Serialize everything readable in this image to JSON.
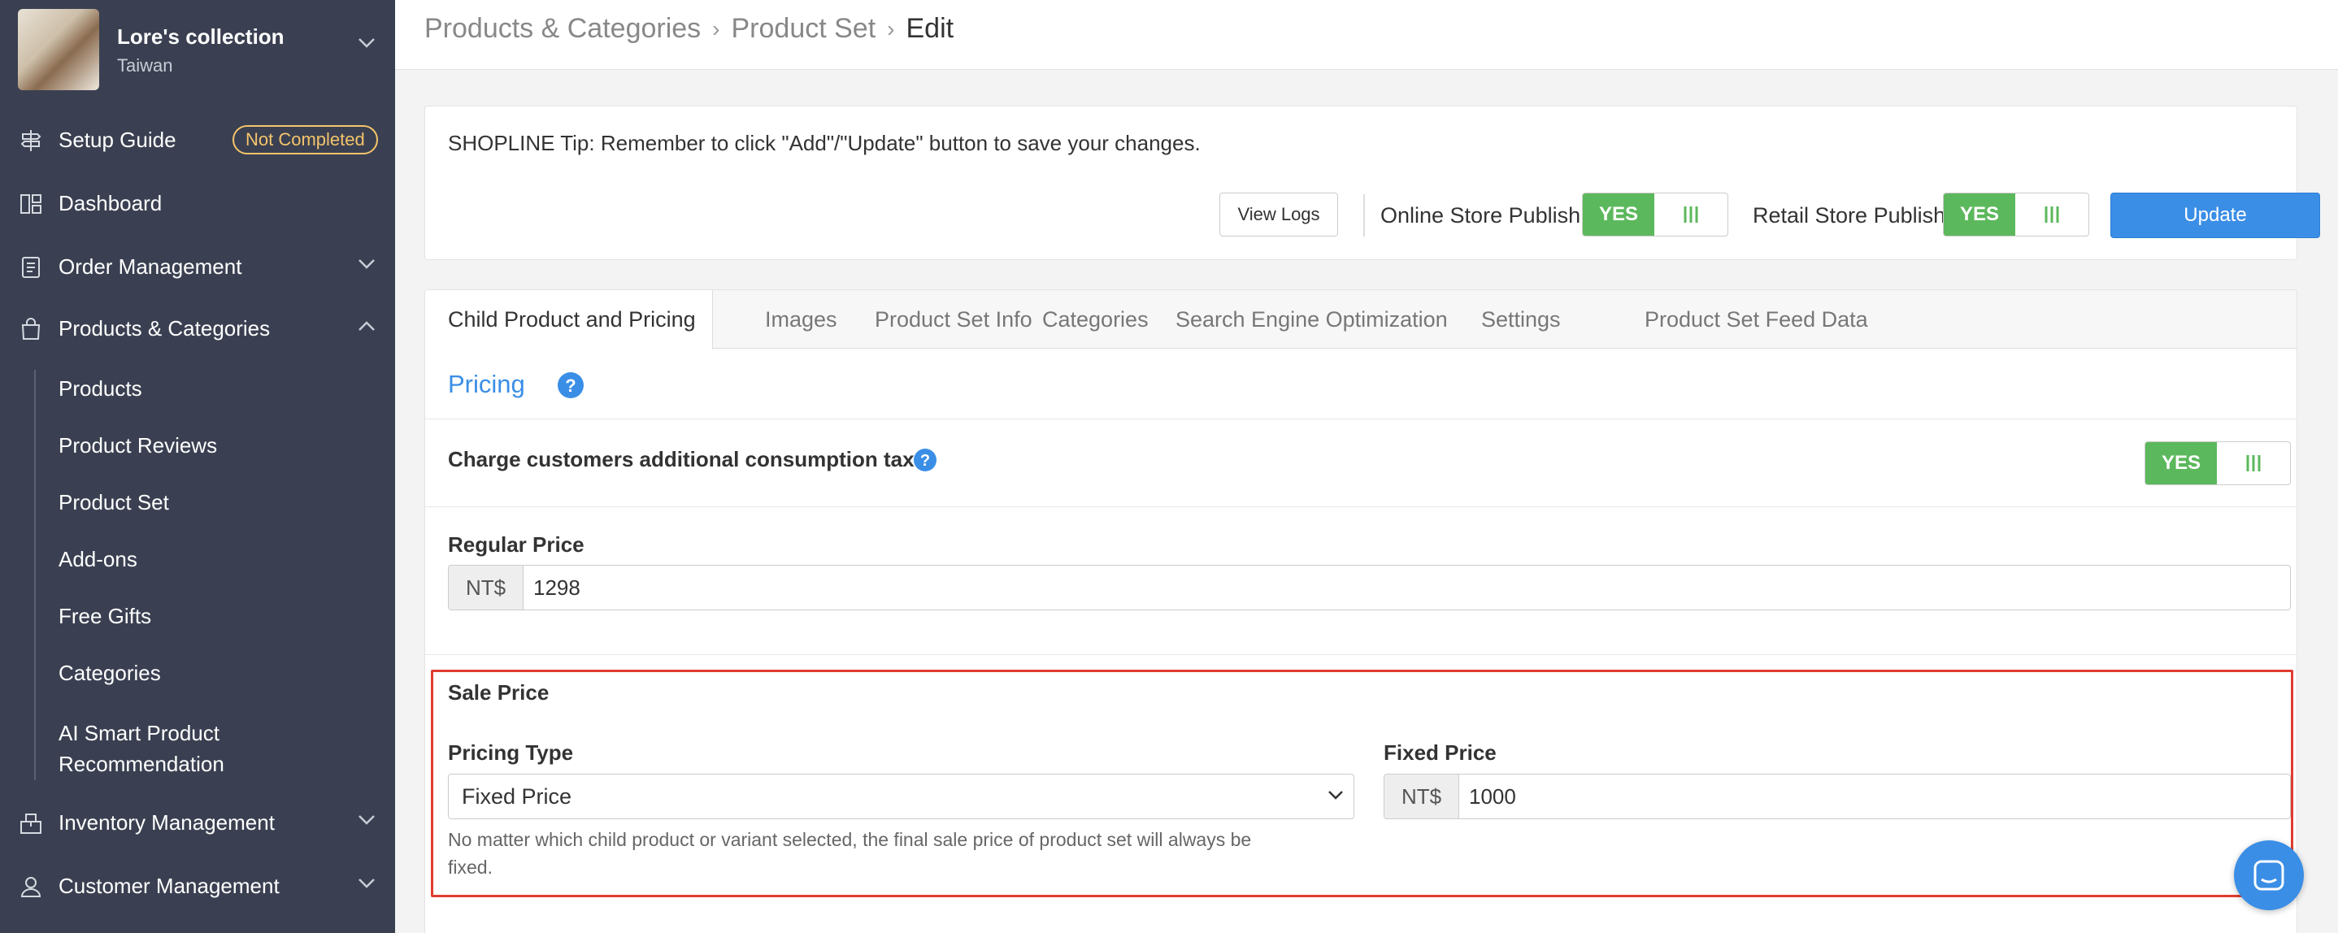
{
  "store": {
    "name": "Lore's collection",
    "region": "Taiwan"
  },
  "sidebar": {
    "setup_guide": {
      "label": "Setup Guide",
      "badge": "Not Completed"
    },
    "items": [
      {
        "label": "Dashboard",
        "icon": "dashboard-icon"
      },
      {
        "label": "Order Management",
        "icon": "order-icon"
      },
      {
        "label": "Products & Categories",
        "icon": "bag-icon"
      },
      {
        "label": "Inventory Management",
        "icon": "inventory-icon"
      },
      {
        "label": "Customer Management",
        "icon": "customer-icon"
      }
    ],
    "sub_items": [
      {
        "label": "Products"
      },
      {
        "label": "Product Reviews"
      },
      {
        "label": "Product Set"
      },
      {
        "label": "Add-ons"
      },
      {
        "label": "Free Gifts"
      },
      {
        "label": "Categories"
      },
      {
        "label": "AI Smart Product",
        "label2": "Recommendation"
      }
    ]
  },
  "breadcrumb": {
    "items": [
      "Products & Categories",
      "Product Set"
    ],
    "current": "Edit"
  },
  "tip": {
    "text": "SHOPLINE Tip: Remember to click \"Add\"/\"Update\" button to save your changes.",
    "view_logs": "View Logs",
    "online_store_publish": "Online Store Publish",
    "retail_store_publish": "Retail Store Publish",
    "yes": "YES",
    "update": "Update"
  },
  "tabs": [
    {
      "label": "Child Product and Pricing",
      "active": true
    },
    {
      "label": "Images"
    },
    {
      "label": "Product Set Info"
    },
    {
      "label": "Categories"
    },
    {
      "label": "Search Engine Optimization"
    },
    {
      "label": "Settings"
    },
    {
      "label": "Product Set Feed Data"
    }
  ],
  "pricing": {
    "title": "Pricing",
    "tax_label": "Charge customers additional consumption tax",
    "tax_toggle": "YES",
    "regular_price_label": "Regular Price",
    "currency": "NT$",
    "regular_price": "1298",
    "sale_price_label": "Sale Price",
    "pricing_type_label": "Pricing Type",
    "pricing_type_value": "Fixed Price",
    "fixed_price_label": "Fixed Price",
    "fixed_price": "1000",
    "help_line1": "No matter which child product or variant selected, the final sale price of product set will always be",
    "help_line2": "fixed."
  },
  "colors": {
    "sidebar": "#3a4051",
    "accent": "#3a8ee6",
    "success": "#5cb85c",
    "highlight": "#e03c31",
    "badge": "#f5c46b"
  }
}
